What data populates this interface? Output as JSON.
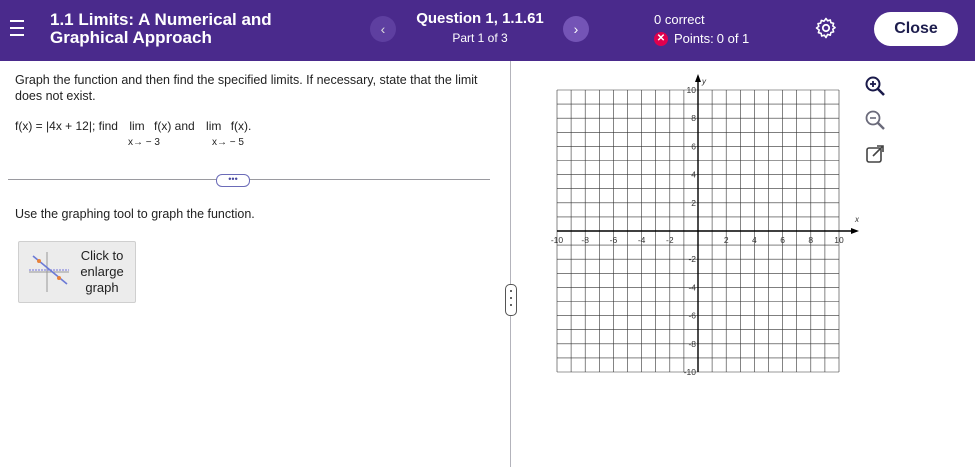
{
  "header": {
    "title_line1": "1.1 Limits: A Numerical and",
    "title_line2": "Graphical Approach",
    "prev_symbol": "‹",
    "next_symbol": "›",
    "question": "Question 1, 1.1.61",
    "part": "Part 1 of 3",
    "correct": "0 correct",
    "points_label": "Points:",
    "points_value": "0 of 1",
    "close_label": "Close",
    "colors": {
      "bar": "#4a2a8c",
      "incorrect": "#e0004d"
    }
  },
  "problem": {
    "instruction": "Graph the function and then find the specified limits. If necessary, state that the limit does not exist.",
    "func_prefix": "f(x) = ",
    "func_abs": "4x + 12",
    "func_suffix": "; find",
    "lim1_word": "lim",
    "lim1_expr": "f(x) and",
    "lim1_sub": "x→ − 3",
    "lim2_word": "lim",
    "lim2_expr": "f(x).",
    "lim2_sub": "x→ − 5",
    "ellipsis": "•••",
    "use_tool": "Use the graphing tool to graph the function.",
    "enlarge_label": "Click to enlarge graph"
  },
  "graph": {
    "x_label": "x",
    "y_label": "y",
    "xlim": [
      -10,
      10
    ],
    "ylim": [
      -10,
      10
    ],
    "x_ticks": [
      "-10",
      "-8",
      "-6",
      "-4",
      "-2",
      "2",
      "4",
      "6",
      "8",
      "10"
    ],
    "y_ticks": [
      "10",
      "8",
      "6",
      "4",
      "2",
      "-2",
      "-4",
      "-6",
      "-8",
      "-10"
    ],
    "grid": true
  },
  "tools": {
    "zoom_in": "zoom-in-icon",
    "zoom_out": "zoom-out-icon",
    "popout": "popout-icon"
  }
}
